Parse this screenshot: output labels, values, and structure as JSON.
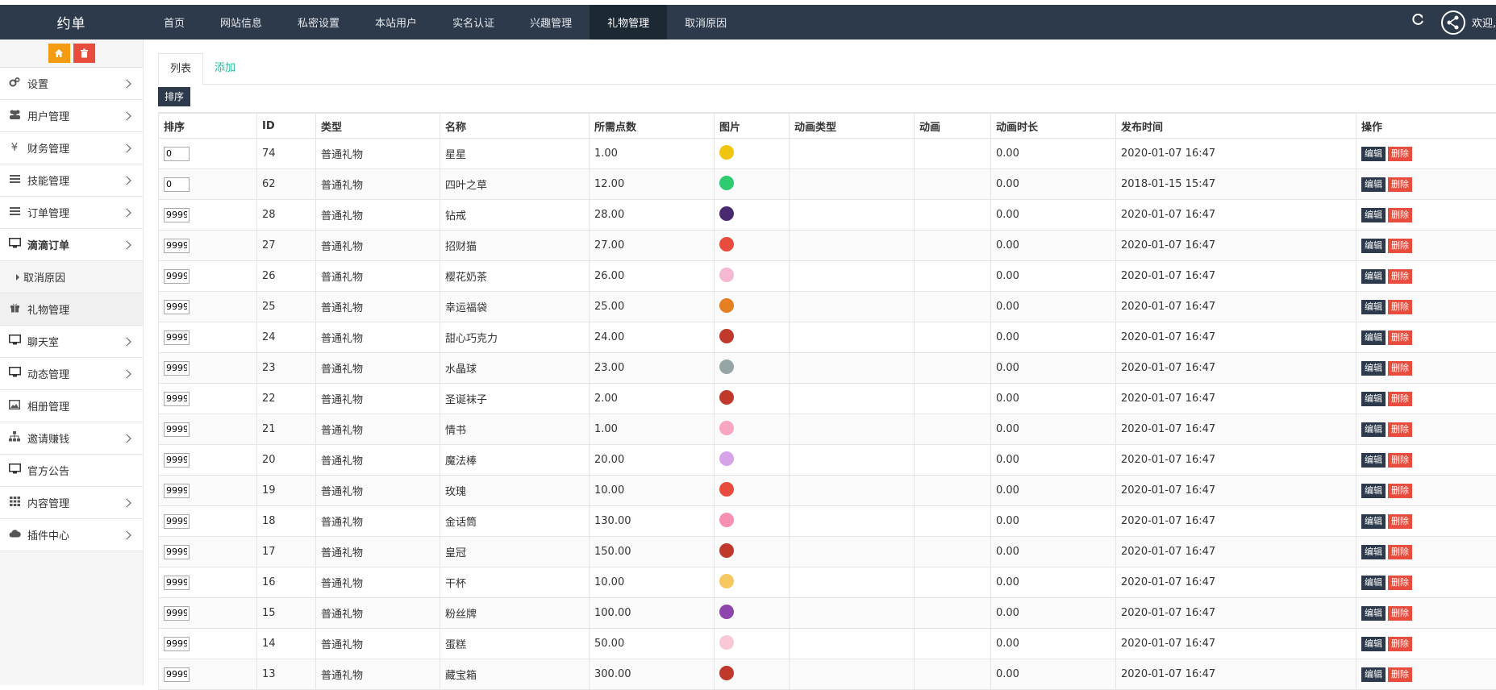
{
  "navbar": {
    "brand": "约单",
    "items": [
      "首页",
      "网站信息",
      "私密设置",
      "本站用户",
      "实名认证",
      "兴趣管理",
      "礼物管理",
      "取消原因"
    ],
    "active_index": 6,
    "welcome": "欢迎, ad"
  },
  "sidebar": {
    "items": [
      {
        "label": "设置",
        "icon": "gears-icon",
        "chevron": true
      },
      {
        "label": "用户管理",
        "icon": "users-icon",
        "chevron": true
      },
      {
        "label": "财务管理",
        "icon": "yen-icon",
        "chevron": true
      },
      {
        "label": "技能管理",
        "icon": "list-icon",
        "chevron": true
      },
      {
        "label": "订单管理",
        "icon": "list-icon",
        "chevron": true
      },
      {
        "label": "滴滴订单",
        "icon": "desktop-icon",
        "chevron": true,
        "open": true
      },
      {
        "label": "取消原因",
        "icon": "",
        "sub": true
      },
      {
        "label": "礼物管理",
        "icon": "gift-icon",
        "chevron": false,
        "current": true
      },
      {
        "label": "聊天室",
        "icon": "desktop-icon",
        "chevron": true
      },
      {
        "label": "动态管理",
        "icon": "desktop-icon",
        "chevron": true
      },
      {
        "label": "相册管理",
        "icon": "image-icon",
        "chevron": false
      },
      {
        "label": "邀请赚钱",
        "icon": "sitemap-icon",
        "chevron": true
      },
      {
        "label": "官方公告",
        "icon": "desktop-icon",
        "chevron": false
      },
      {
        "label": "内容管理",
        "icon": "grid-icon",
        "chevron": true
      },
      {
        "label": "插件中心",
        "icon": "cloud-icon",
        "chevron": true
      }
    ]
  },
  "tabs": {
    "list": "列表",
    "add": "添加"
  },
  "sort_button": "排序",
  "table": {
    "headers": [
      "排序",
      "ID",
      "类型",
      "名称",
      "所需点数",
      "图片",
      "动画类型",
      "动画",
      "动画时长",
      "发布时间",
      "操作"
    ],
    "edit_label": "编辑",
    "delete_label": "删除",
    "rows": [
      {
        "sort": "0",
        "id": "74",
        "type": "普通礼物",
        "name": "星星",
        "points": "1.00",
        "color": "#f1c40f",
        "anim_type": "",
        "anim": "",
        "duration": "0.00",
        "time": "2020-01-07 16:47"
      },
      {
        "sort": "0",
        "id": "62",
        "type": "普通礼物",
        "name": "四叶之草",
        "points": "12.00",
        "color": "#2ecc71",
        "anim_type": "",
        "anim": "",
        "duration": "0.00",
        "time": "2018-01-15 15:47"
      },
      {
        "sort": "9999",
        "id": "28",
        "type": "普通礼物",
        "name": "钻戒",
        "points": "28.00",
        "color": "#4a2a6e",
        "anim_type": "",
        "anim": "",
        "duration": "0.00",
        "time": "2020-01-07 16:47"
      },
      {
        "sort": "9999",
        "id": "27",
        "type": "普通礼物",
        "name": "招财猫",
        "points": "27.00",
        "color": "#e74c3c",
        "anim_type": "",
        "anim": "",
        "duration": "0.00",
        "time": "2020-01-07 16:47"
      },
      {
        "sort": "9999",
        "id": "26",
        "type": "普通礼物",
        "name": "樱花奶茶",
        "points": "26.00",
        "color": "#f5b7d1",
        "anim_type": "",
        "anim": "",
        "duration": "0.00",
        "time": "2020-01-07 16:47"
      },
      {
        "sort": "9999",
        "id": "25",
        "type": "普通礼物",
        "name": "幸运福袋",
        "points": "25.00",
        "color": "#e67e22",
        "anim_type": "",
        "anim": "",
        "duration": "0.00",
        "time": "2020-01-07 16:47"
      },
      {
        "sort": "9999",
        "id": "24",
        "type": "普通礼物",
        "name": "甜心巧克力",
        "points": "24.00",
        "color": "#c0392b",
        "anim_type": "",
        "anim": "",
        "duration": "0.00",
        "time": "2020-01-07 16:47"
      },
      {
        "sort": "9999",
        "id": "23",
        "type": "普通礼物",
        "name": "水晶球",
        "points": "23.00",
        "color": "#95a5a6",
        "anim_type": "",
        "anim": "",
        "duration": "0.00",
        "time": "2020-01-07 16:47"
      },
      {
        "sort": "9999",
        "id": "22",
        "type": "普通礼物",
        "name": "圣诞袜子",
        "points": "2.00",
        "color": "#c0392b",
        "anim_type": "",
        "anim": "",
        "duration": "0.00",
        "time": "2020-01-07 16:47"
      },
      {
        "sort": "9999",
        "id": "21",
        "type": "普通礼物",
        "name": "情书",
        "points": "1.00",
        "color": "#f8a5c2",
        "anim_type": "",
        "anim": "",
        "duration": "0.00",
        "time": "2020-01-07 16:47"
      },
      {
        "sort": "9999",
        "id": "20",
        "type": "普通礼物",
        "name": "魔法棒",
        "points": "20.00",
        "color": "#d6a2e8",
        "anim_type": "",
        "anim": "",
        "duration": "0.00",
        "time": "2020-01-07 16:47"
      },
      {
        "sort": "9999",
        "id": "19",
        "type": "普通礼物",
        "name": "玫瑰",
        "points": "10.00",
        "color": "#e74c3c",
        "anim_type": "",
        "anim": "",
        "duration": "0.00",
        "time": "2020-01-07 16:47"
      },
      {
        "sort": "9999",
        "id": "18",
        "type": "普通礼物",
        "name": "金话筒",
        "points": "130.00",
        "color": "#f78fb3",
        "anim_type": "",
        "anim": "",
        "duration": "0.00",
        "time": "2020-01-07 16:47"
      },
      {
        "sort": "9999",
        "id": "17",
        "type": "普通礼物",
        "name": "皇冠",
        "points": "150.00",
        "color": "#c0392b",
        "anim_type": "",
        "anim": "",
        "duration": "0.00",
        "time": "2020-01-07 16:47"
      },
      {
        "sort": "9999",
        "id": "16",
        "type": "普通礼物",
        "name": "干杯",
        "points": "10.00",
        "color": "#f6c85f",
        "anim_type": "",
        "anim": "",
        "duration": "0.00",
        "time": "2020-01-07 16:47"
      },
      {
        "sort": "9999",
        "id": "15",
        "type": "普通礼物",
        "name": "粉丝牌",
        "points": "100.00",
        "color": "#8e44ad",
        "anim_type": "",
        "anim": "",
        "duration": "0.00",
        "time": "2020-01-07 16:47"
      },
      {
        "sort": "9999",
        "id": "14",
        "type": "普通礼物",
        "name": "蛋糕",
        "points": "50.00",
        "color": "#f8c9d4",
        "anim_type": "",
        "anim": "",
        "duration": "0.00",
        "time": "2020-01-07 16:47"
      },
      {
        "sort": "9999",
        "id": "13",
        "type": "普通礼物",
        "name": "藏宝箱",
        "points": "300.00",
        "color": "#c0392b",
        "anim_type": "",
        "anim": "",
        "duration": "0.00",
        "time": "2020-01-07 16:47"
      }
    ]
  }
}
